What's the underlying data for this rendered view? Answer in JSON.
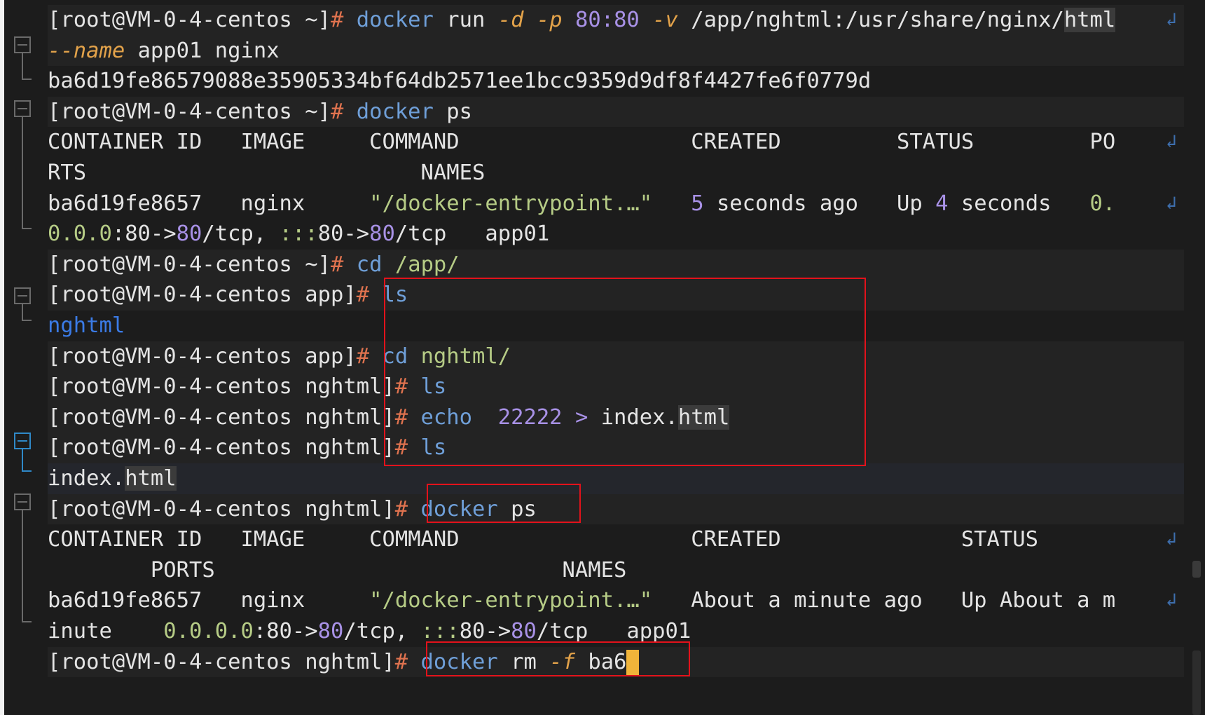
{
  "prompt": {
    "user_host_home": "[root@VM-0-4-centos ~]",
    "user_host_app": "[root@VM-0-4-centos app]",
    "user_host_nghtml": "[root@VM-0-4-centos nghtml]",
    "hash": "#"
  },
  "lines": {
    "l1": {
      "cmd": "docker",
      "sub": "run",
      "f1": "-d",
      "f2": "-p",
      "port": "80:80",
      "f3": "-v",
      "path_a": "/app/nghtml:/usr/share/nginx/",
      "path_b": "html"
    },
    "l2": {
      "flag": "--name",
      "rest": "app01 nginx"
    },
    "l3": {
      "text": "ba6d19fe86579088e35905334bf64db2571ee1bcc9359d9df8f4427fe6f0779d"
    },
    "l4": {
      "cmd": "docker",
      "sub": "ps"
    },
    "l5": {
      "c1": "CONTAINER ID",
      "c2": "IMAGE",
      "c3": "COMMAND",
      "c4": "CREATED",
      "c5": "STATUS",
      "c6": "PO"
    },
    "l6": {
      "c1": "RTS",
      "c2": "NAMES"
    },
    "l7": {
      "id": "ba6d19fe8657",
      "image": "nginx",
      "command": "\"/docker-entrypoint.…\"",
      "n1": "5",
      "created": "seconds ago",
      "up": "Up",
      "n2": "4",
      "upt": "seconds",
      "ip": "0."
    },
    "l8": {
      "a": "0.0.0",
      "b": ":80->",
      "c": "80",
      "d": "/tcp,",
      "e": ":::",
      "f": "80->",
      "g": "80",
      "h": "/tcp",
      "name": "app01"
    },
    "l9": {
      "cmd": "cd",
      "arg": "/app/"
    },
    "l10": {
      "cmd": "ls"
    },
    "l11": {
      "dir": "nghtml"
    },
    "l12": {
      "cmd": "cd",
      "arg": "nghtml/"
    },
    "l13": {
      "cmd": "ls"
    },
    "l14": {
      "cmd": "echo",
      "num": "22222",
      "op": ">",
      "file_a": "index.",
      "file_b": "html"
    },
    "l15": {
      "cmd": "ls"
    },
    "l16": {
      "file_a": "index.",
      "file_b": "html"
    },
    "l17": {
      "cmd": "docker",
      "sub": "ps"
    },
    "l18": {
      "c1": "CONTAINER ID",
      "c2": "IMAGE",
      "c3": "COMMAND",
      "c4": "CREATED",
      "c5": "STATUS"
    },
    "l19": {
      "c1": "PORTS",
      "c2": "NAMES"
    },
    "l20": {
      "id": "ba6d19fe8657",
      "image": "nginx",
      "command": "\"/docker-entrypoint.…\"",
      "created": "About a minute ago",
      "status": "Up About a m"
    },
    "l21": {
      "a": "inute",
      "b": "0.0.0.0",
      "c": ":80->",
      "d": "80",
      "e": "/tcp,",
      "f": ":::",
      "g": "80->",
      "h": "80",
      "i": "/tcp",
      "name": "app01"
    },
    "l22": {
      "cmd": "docker",
      "sub": "rm",
      "flag": "-f",
      "arg": "ba6"
    }
  },
  "icons": {
    "wrap": "wrap-arrow-icon",
    "fold": "fold-toggle-icon"
  },
  "colors": {
    "highlight_box": "#e3121b",
    "command": "#6f9fd8",
    "flag": "#e2a24a",
    "number": "#a891e6",
    "cursor": "#f0b43a"
  }
}
